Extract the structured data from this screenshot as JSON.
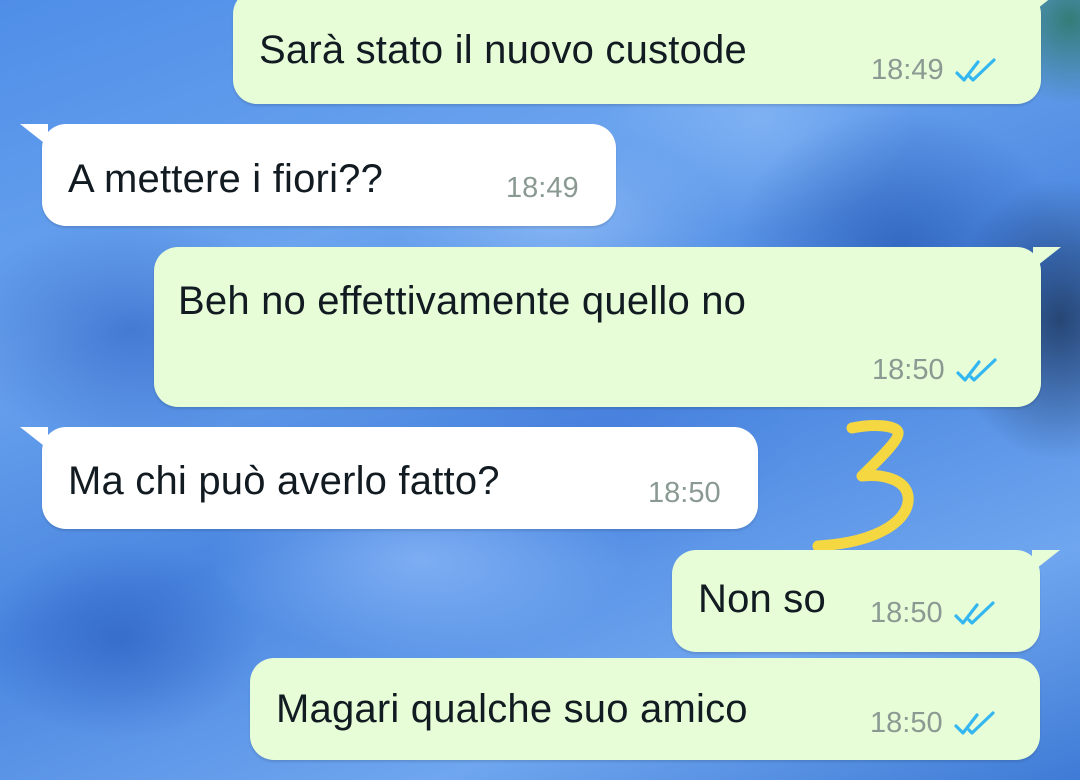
{
  "chat": {
    "messages": [
      {
        "direction": "outgoing",
        "text": "Sarà stato il nuovo custode",
        "time": "18:49",
        "status": "read"
      },
      {
        "direction": "incoming",
        "text": "A mettere i fiori??",
        "time": "18:49"
      },
      {
        "direction": "outgoing",
        "text": "Beh no effettivamente quello no",
        "time": "18:50",
        "status": "read"
      },
      {
        "direction": "incoming",
        "text": "Ma chi può averlo fatto?",
        "time": "18:50"
      },
      {
        "direction": "outgoing",
        "text": "Non so",
        "time": "18:50",
        "status": "read"
      },
      {
        "direction": "outgoing",
        "text": "Magari qualche suo amico",
        "time": "18:50",
        "status": "read"
      }
    ]
  },
  "annotation": {
    "text": "3",
    "color": "#f5d742"
  },
  "colors": {
    "outgoing_bubble": "#e6fdd7",
    "incoming_bubble": "#ffffff",
    "read_ticks": "#34b7f1",
    "timestamp": "#8a9a92"
  },
  "icons": {
    "read_receipt": "double-check-icon"
  }
}
